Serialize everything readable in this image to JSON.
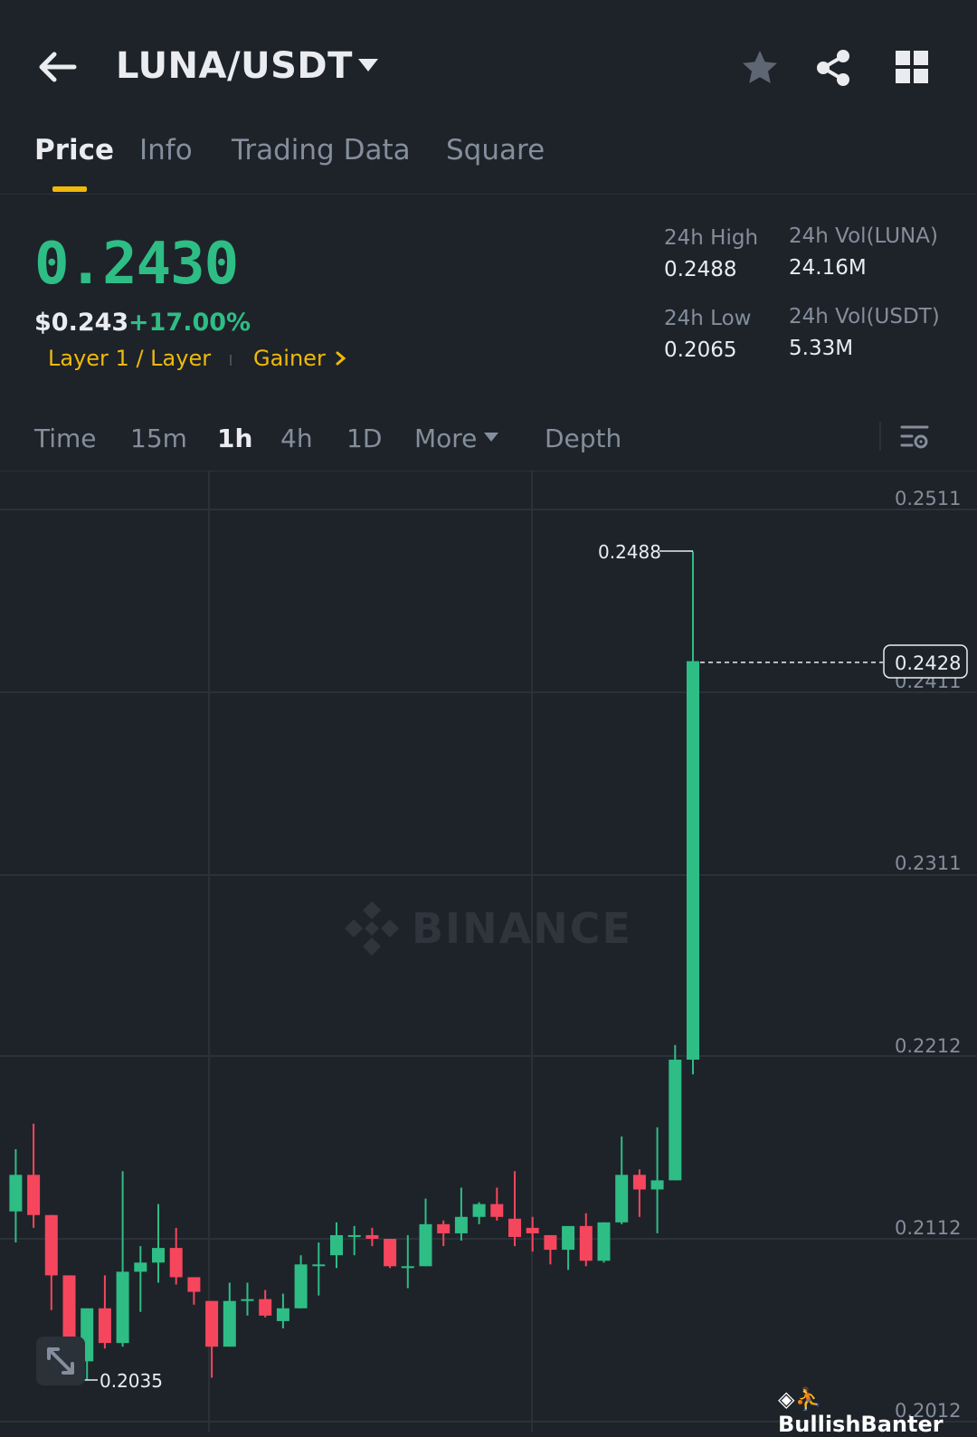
{
  "header": {
    "title": "LUNA/USDT"
  },
  "tabs": [
    {
      "label": "Price",
      "active": true
    },
    {
      "label": "Info"
    },
    {
      "label": "Trading Data"
    },
    {
      "label": "Square"
    }
  ],
  "ticker": {
    "last_price": "0.2430",
    "usd_price": "$0.243",
    "change": "+17.00%",
    "tag1": "Layer 1 / Layer",
    "tag2": "Gainer",
    "stats": {
      "high_label": "24h High",
      "high_value": "0.2488",
      "low_label": "24h Low",
      "low_value": "0.2065",
      "vol_base_label": "24h Vol(LUNA)",
      "vol_base_value": "24.16M",
      "vol_quote_label": "24h Vol(USDT)",
      "vol_quote_value": "5.33M"
    }
  },
  "intervals": [
    {
      "label": "Time"
    },
    {
      "label": "15m"
    },
    {
      "label": "1h",
      "active": true
    },
    {
      "label": "4h"
    },
    {
      "label": "1D"
    },
    {
      "label": "More"
    },
    {
      "label": "Depth"
    }
  ],
  "chart": {
    "watermark": "BINANCE",
    "high_marker": "0.2488",
    "low_marker": "0.2035",
    "current_price": "0.2428",
    "axis_labels": [
      "0.2511",
      "0.2411",
      "0.2311",
      "0.2212",
      "0.2112",
      "0.2012"
    ]
  },
  "chart_data": {
    "type": "candlestick",
    "y_axis_ticks": [
      0.2511,
      0.2411,
      0.2311,
      0.2212,
      0.2112,
      0.2012
    ],
    "ylim": [
      0.2005,
      0.2533
    ],
    "up_color": "#2ebd85",
    "down_color": "#f6465d",
    "candles": [
      {
        "o": 0.2127,
        "h": 0.2161,
        "l": 0.211,
        "c": 0.2147
      },
      {
        "o": 0.2147,
        "h": 0.2175,
        "l": 0.2118,
        "c": 0.2125
      },
      {
        "o": 0.2125,
        "h": 0.2125,
        "l": 0.2073,
        "c": 0.2092
      },
      {
        "o": 0.2092,
        "h": 0.2092,
        "l": 0.2039,
        "c": 0.2055
      },
      {
        "o": 0.2045,
        "h": 0.2065,
        "l": 0.2035,
        "c": 0.2074
      },
      {
        "o": 0.2074,
        "h": 0.2092,
        "l": 0.2052,
        "c": 0.2055
      },
      {
        "o": 0.2055,
        "h": 0.2149,
        "l": 0.2053,
        "c": 0.2094
      },
      {
        "o": 0.2094,
        "h": 0.2108,
        "l": 0.2072,
        "c": 0.2099
      },
      {
        "o": 0.2099,
        "h": 0.2131,
        "l": 0.2088,
        "c": 0.2107
      },
      {
        "o": 0.2107,
        "h": 0.2118,
        "l": 0.2087,
        "c": 0.2091
      },
      {
        "o": 0.2091,
        "h": 0.2091,
        "l": 0.2076,
        "c": 0.2083
      },
      {
        "o": 0.2078,
        "h": 0.2078,
        "l": 0.2036,
        "c": 0.2053
      },
      {
        "o": 0.2053,
        "h": 0.2088,
        "l": 0.2053,
        "c": 0.2078
      },
      {
        "o": 0.2078,
        "h": 0.2088,
        "l": 0.207,
        "c": 0.2079
      },
      {
        "o": 0.2079,
        "h": 0.2084,
        "l": 0.2069,
        "c": 0.207
      },
      {
        "o": 0.2067,
        "h": 0.2082,
        "l": 0.2063,
        "c": 0.2074
      },
      {
        "o": 0.2074,
        "h": 0.2103,
        "l": 0.2074,
        "c": 0.2098
      },
      {
        "o": 0.2098,
        "h": 0.211,
        "l": 0.2081,
        "c": 0.2098
      },
      {
        "o": 0.2103,
        "h": 0.2121,
        "l": 0.2096,
        "c": 0.2114
      },
      {
        "o": 0.2114,
        "h": 0.2119,
        "l": 0.2103,
        "c": 0.2114
      },
      {
        "o": 0.2114,
        "h": 0.2118,
        "l": 0.2108,
        "c": 0.2112
      },
      {
        "o": 0.2112,
        "h": 0.2112,
        "l": 0.2096,
        "c": 0.2097
      },
      {
        "o": 0.2097,
        "h": 0.2114,
        "l": 0.2085,
        "c": 0.2097
      },
      {
        "o": 0.2097,
        "h": 0.2134,
        "l": 0.2097,
        "c": 0.212
      },
      {
        "o": 0.212,
        "h": 0.2122,
        "l": 0.2108,
        "c": 0.2115
      },
      {
        "o": 0.2115,
        "h": 0.214,
        "l": 0.2111,
        "c": 0.2124
      },
      {
        "o": 0.2124,
        "h": 0.2132,
        "l": 0.212,
        "c": 0.2131
      },
      {
        "o": 0.2131,
        "h": 0.214,
        "l": 0.2122,
        "c": 0.2124
      },
      {
        "o": 0.2123,
        "h": 0.2149,
        "l": 0.2108,
        "c": 0.2113
      },
      {
        "o": 0.2118,
        "h": 0.2124,
        "l": 0.2105,
        "c": 0.2115
      },
      {
        "o": 0.2114,
        "h": 0.2114,
        "l": 0.2098,
        "c": 0.2106
      },
      {
        "o": 0.2106,
        "h": 0.2118,
        "l": 0.2095,
        "c": 0.2119
      },
      {
        "o": 0.2119,
        "h": 0.2126,
        "l": 0.2097,
        "c": 0.21
      },
      {
        "o": 0.21,
        "h": 0.2121,
        "l": 0.2099,
        "c": 0.2121
      },
      {
        "o": 0.2121,
        "h": 0.2168,
        "l": 0.212,
        "c": 0.2147
      },
      {
        "o": 0.2147,
        "h": 0.215,
        "l": 0.2124,
        "c": 0.2139
      },
      {
        "o": 0.2139,
        "h": 0.2173,
        "l": 0.2115,
        "c": 0.2144
      },
      {
        "o": 0.2144,
        "h": 0.2218,
        "l": 0.2144,
        "c": 0.221
      },
      {
        "o": 0.221,
        "h": 0.2488,
        "l": 0.2202,
        "c": 0.2428
      }
    ]
  }
}
